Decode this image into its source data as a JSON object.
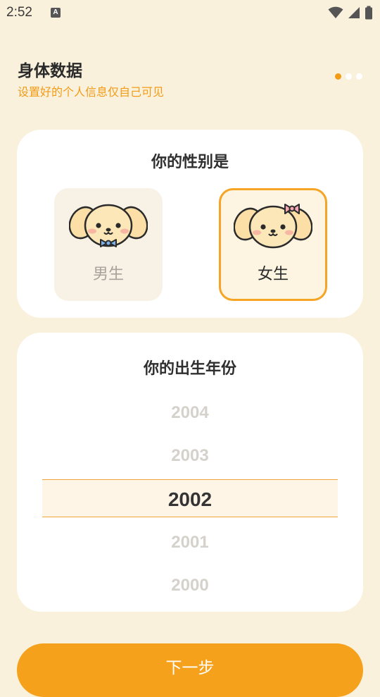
{
  "status_bar": {
    "time": "2:52",
    "notification_icon": "A",
    "icons": [
      "wifi-icon",
      "signal-icon",
      "battery-icon"
    ]
  },
  "header": {
    "title": "身体数据",
    "subtitle": "设置好的个人信息仅自己可见",
    "step_current": 1,
    "step_total": 3
  },
  "gender": {
    "title": "你的性别是",
    "options": [
      {
        "label": "男生",
        "icon": "dog-with-bowtie-icon",
        "selected": false
      },
      {
        "label": "女生",
        "icon": "dog-with-hair-bow-icon",
        "selected": true
      }
    ]
  },
  "birth_year": {
    "title": "你的出生年份",
    "years": [
      "2004",
      "2003",
      "2002",
      "2001",
      "2000"
    ],
    "selected": "2002"
  },
  "actions": {
    "next_label": "下一步"
  },
  "colors": {
    "background": "#FAF1DC",
    "accent": "#F6A11C",
    "card": "#FFFFFF"
  }
}
